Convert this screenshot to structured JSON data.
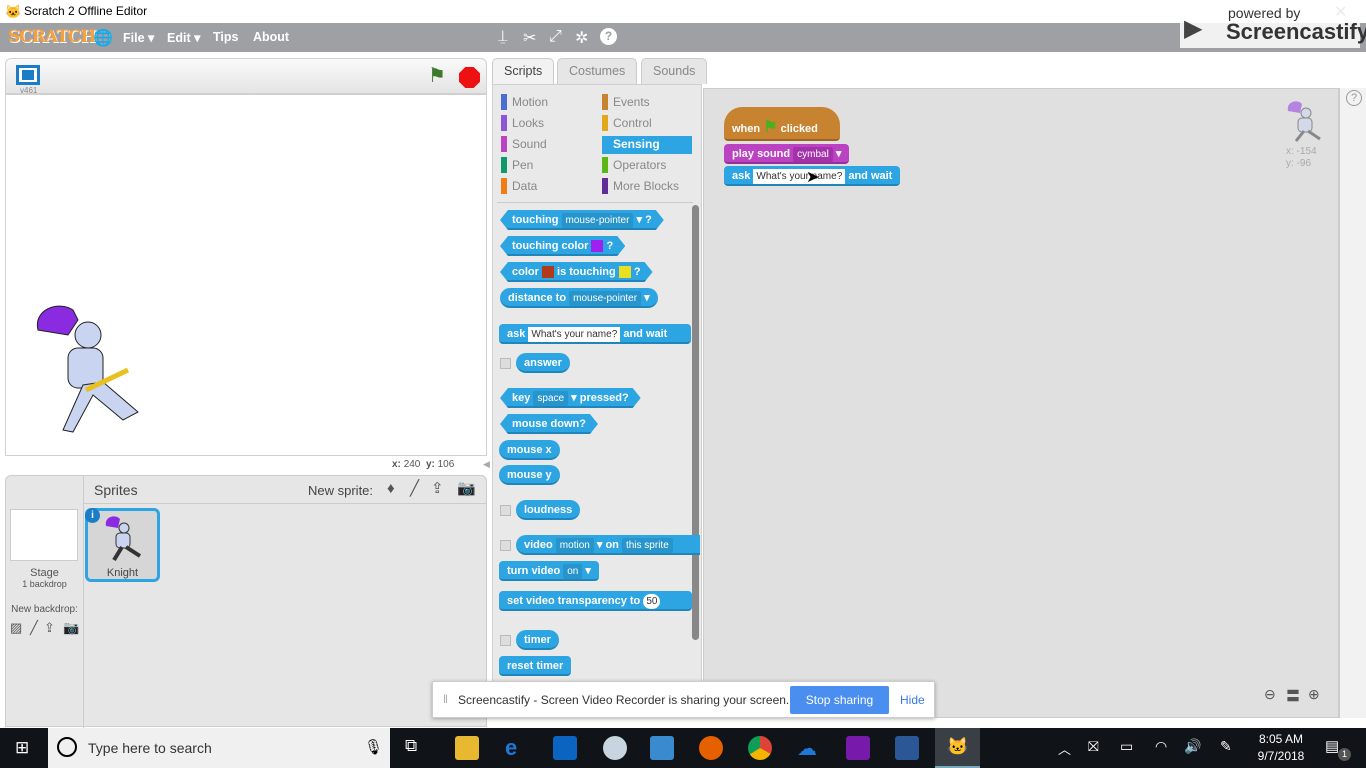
{
  "window": {
    "title": "Scratch 2 Offline Editor"
  },
  "menu": {
    "logo": "SCRATCH",
    "items": [
      "File ▾",
      "Edit ▾",
      "Tips",
      "About"
    ],
    "toolbar_icons": [
      "duplicate-stamp-icon",
      "cut-scissors-icon",
      "grow-icon",
      "shrink-icon",
      "help-icon"
    ]
  },
  "stage": {
    "version": "v461",
    "mouse_x_label": "x:",
    "mouse_x": "240",
    "mouse_y_label": "y:",
    "mouse_y": "106"
  },
  "tabs": [
    "Scripts",
    "Costumes",
    "Sounds"
  ],
  "categories": [
    {
      "label": "Motion",
      "color": "#4a6cd4"
    },
    {
      "label": "Events",
      "color": "#c88330"
    },
    {
      "label": "Looks",
      "color": "#8a55d7"
    },
    {
      "label": "Control",
      "color": "#e1a91a"
    },
    {
      "label": "Sound",
      "color": "#bb42c3"
    },
    {
      "label": "Sensing",
      "color": "#2ca5e2"
    },
    {
      "label": "Pen",
      "color": "#0e9a6c"
    },
    {
      "label": "Operators",
      "color": "#5cb712"
    },
    {
      "label": "Data",
      "color": "#ee7d16"
    },
    {
      "label": "More Blocks",
      "color": "#632d99"
    }
  ],
  "selected_category": "Sensing",
  "palette": {
    "touching": "touching",
    "mouse_pointer": "mouse-pointer",
    "q": "?",
    "touching_color": "touching color",
    "color": "color",
    "is_touching": "is touching",
    "distance_to": "distance to",
    "ask": "ask",
    "ask_default": "What's your name?",
    "and_wait": "and wait",
    "answer": "answer",
    "key": "key",
    "space": "space",
    "pressed": "pressed?",
    "mouse_down": "mouse down?",
    "mouse_x": "mouse x",
    "mouse_y": "mouse y",
    "loudness": "loudness",
    "video": "video",
    "motion": "motion",
    "on": "on",
    "this_sprite": "this sprite",
    "turn_video": "turn video",
    "on_opt": "on",
    "set_video_transparency": "set video transparency to",
    "transparency": "50",
    "timer": "timer",
    "reset_timer": "reset timer"
  },
  "script": {
    "when": "when",
    "clicked": "clicked",
    "play_sound": "play sound",
    "sound": "cymbal",
    "ask": "ask",
    "question": "What's your name?",
    "and_wait": "and wait",
    "sprite_x": "x: -154",
    "sprite_y": "y: -96"
  },
  "sprites": {
    "header": "Sprites",
    "new_sprite": "New sprite:",
    "stage_label": "Stage",
    "backdrops": "1 backdrop",
    "new_backdrop": "New backdrop:",
    "items": [
      {
        "name": "Knight"
      }
    ]
  },
  "screencastify": {
    "powered_by": "powered by",
    "brand": "Screencastify",
    "message": "Screencastify - Screen Video Recorder is sharing your screen.",
    "stop": "Stop sharing",
    "hide": "Hide"
  },
  "taskbar": {
    "search_placeholder": "Type here to search",
    "time": "8:05 AM",
    "date": "9/7/2018",
    "notifications": "1"
  }
}
